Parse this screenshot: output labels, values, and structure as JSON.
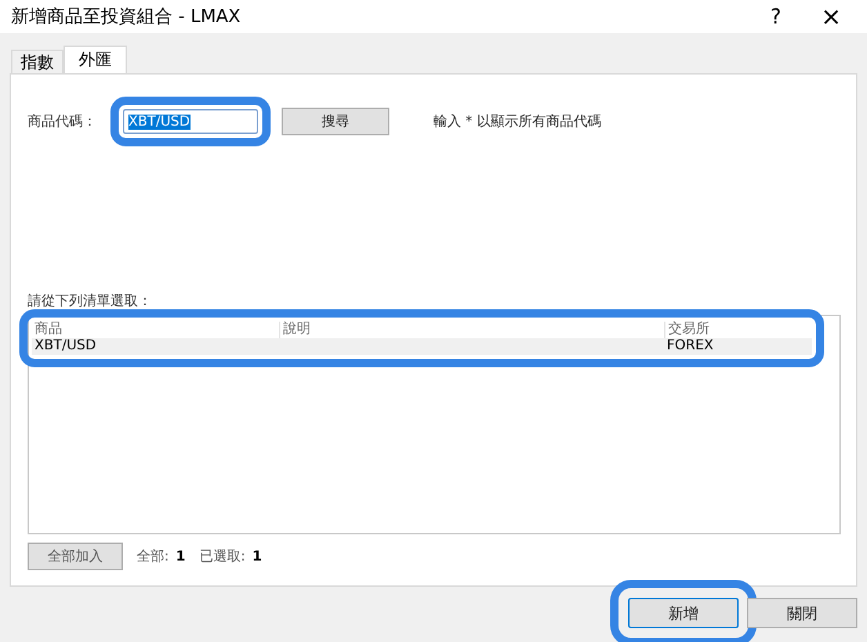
{
  "window": {
    "title": "新增商品至投資組合 - LMAX",
    "help": "?",
    "close": "×"
  },
  "tabs": [
    {
      "label": "指數",
      "selected": false
    },
    {
      "label": "外匯",
      "selected": true
    }
  ],
  "symbol_field": {
    "label": "商品代碼：",
    "value": "XBT/USD",
    "value_selected": true,
    "highlighted": true
  },
  "search_button": "搜尋",
  "hint": "輸入 * 以顯示所有商品代碼",
  "list_label": "請從下列清單選取：",
  "table": {
    "highlighted": true,
    "columns": [
      "商品",
      "說明",
      "交易所"
    ],
    "rows": [
      {
        "cells": [
          "XBT/USD",
          "",
          "FOREX"
        ],
        "selected": true
      }
    ]
  },
  "add_all_button": "全部加入",
  "counts": [
    {
      "label": "全部:",
      "value": "1"
    },
    {
      "label": "已選取:",
      "value": "1"
    }
  ],
  "buttons": [
    {
      "label": "新增",
      "default": true,
      "highlighted": true
    },
    {
      "label": "關閉",
      "default": false,
      "highlighted": false
    }
  ]
}
